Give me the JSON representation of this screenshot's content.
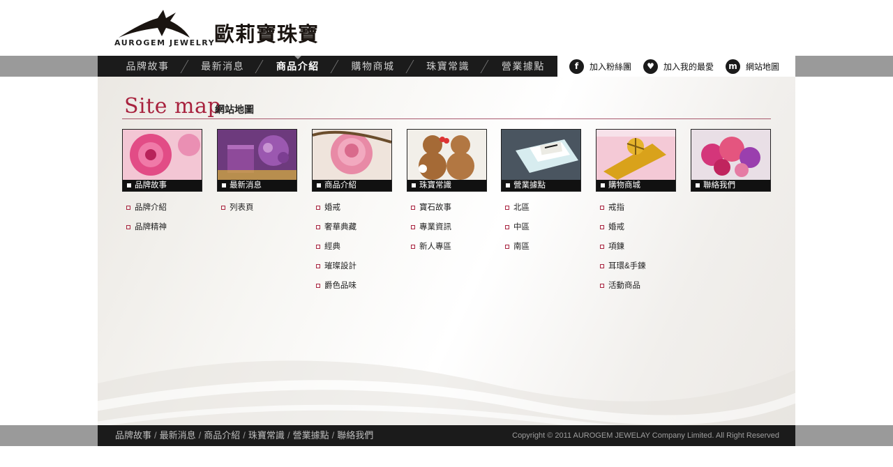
{
  "brand": {
    "logo_text": "AUROGEM JEWELRY",
    "name_cn": "歐莉寶珠寶"
  },
  "nav": {
    "items": [
      {
        "label": "品牌故事",
        "active": false
      },
      {
        "label": "最新消息",
        "active": false
      },
      {
        "label": "商品介紹",
        "active": true
      },
      {
        "label": "購物商城",
        "active": false
      },
      {
        "label": "珠寶常識",
        "active": false
      },
      {
        "label": "營業據點",
        "active": false
      }
    ]
  },
  "utility": {
    "fan_icon": "facebook-icon",
    "fan_label": "加入粉絲團",
    "fav_icon": "heart-icon",
    "fav_label": "加入我的最愛",
    "map_icon": "m-icon",
    "map_label": "網站地圖"
  },
  "page_title": {
    "en": "Site map",
    "cn": "網站地圖"
  },
  "sections": [
    {
      "caption": "品牌故事",
      "image": "pink-flower-photo",
      "links": [
        "品牌介紹",
        "品牌精神"
      ]
    },
    {
      "caption": "最新消息",
      "image": "purple-candle-photo",
      "links": [
        "列表頁"
      ]
    },
    {
      "caption": "商品介紹",
      "image": "pink-rose-photo",
      "links": [
        "婚戒",
        "奢華典藏",
        "經典",
        "璀璨設計",
        "爵色品味"
      ]
    },
    {
      "caption": "珠寶常識",
      "image": "teddy-bears-photo",
      "links": [
        "寶石故事",
        "專業資訊",
        "新人專區"
      ]
    },
    {
      "caption": "營業據點",
      "image": "table-setting-photo",
      "links": [
        "北區",
        "中區",
        "南區"
      ]
    },
    {
      "caption": "購物商城",
      "image": "champagne-gift-photo",
      "links": [
        "戒指",
        "婚戒",
        "項鍊",
        "耳環&手鍊",
        "活動商品"
      ]
    },
    {
      "caption": "聯絡我們",
      "image": "flower-bouquet-photo",
      "links": []
    }
  ],
  "footer": {
    "links": [
      "品牌故事",
      "最新消息",
      "商品介紹",
      "珠寶常識",
      "營業據點",
      "聯絡我們"
    ],
    "copyright": "Copyright © 2011 AUROGEM JEWELAY Company Limited. All Right Reserved"
  },
  "colors": {
    "accent": "#a8223e",
    "bar": "#1b1b1b",
    "band": "#9a9a9a"
  }
}
